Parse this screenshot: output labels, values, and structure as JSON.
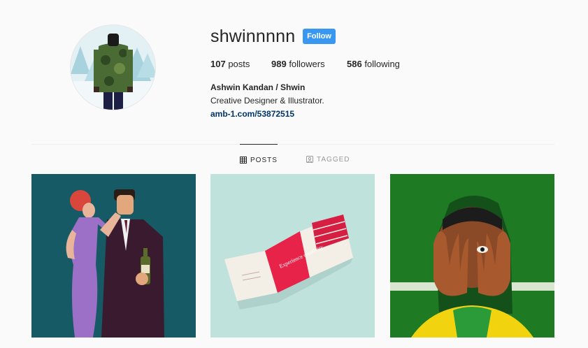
{
  "profile": {
    "username": "shwinnnnn",
    "follow_label": "Follow",
    "full_name": "Ashwin Kandan / Shwin",
    "bio": "Creative Designer & Illustrator.",
    "link": "amb-1.com/53872515"
  },
  "stats": {
    "posts_count": "107",
    "posts_label": " posts",
    "followers_count": "989",
    "followers_label": " followers",
    "following_count": "586",
    "following_label": " following"
  },
  "tabs": [
    {
      "label": "POSTS",
      "active": true,
      "icon": "grid-icon"
    },
    {
      "label": "TAGGED",
      "active": false,
      "icon": "tag-icon"
    }
  ],
  "posts": [
    {
      "subject": "couple-illustration"
    },
    {
      "subject": "folded-card-mockup"
    },
    {
      "subject": "face-covered-illustration"
    }
  ],
  "card_text": "Experience creativity",
  "colors": {
    "follow_button": "#3897f0",
    "link": "#003569",
    "divider": "#efefef",
    "post1_bg": "#155a64",
    "post2_bg": "#bfe2dc",
    "post3_bg": "#1f7a24"
  }
}
